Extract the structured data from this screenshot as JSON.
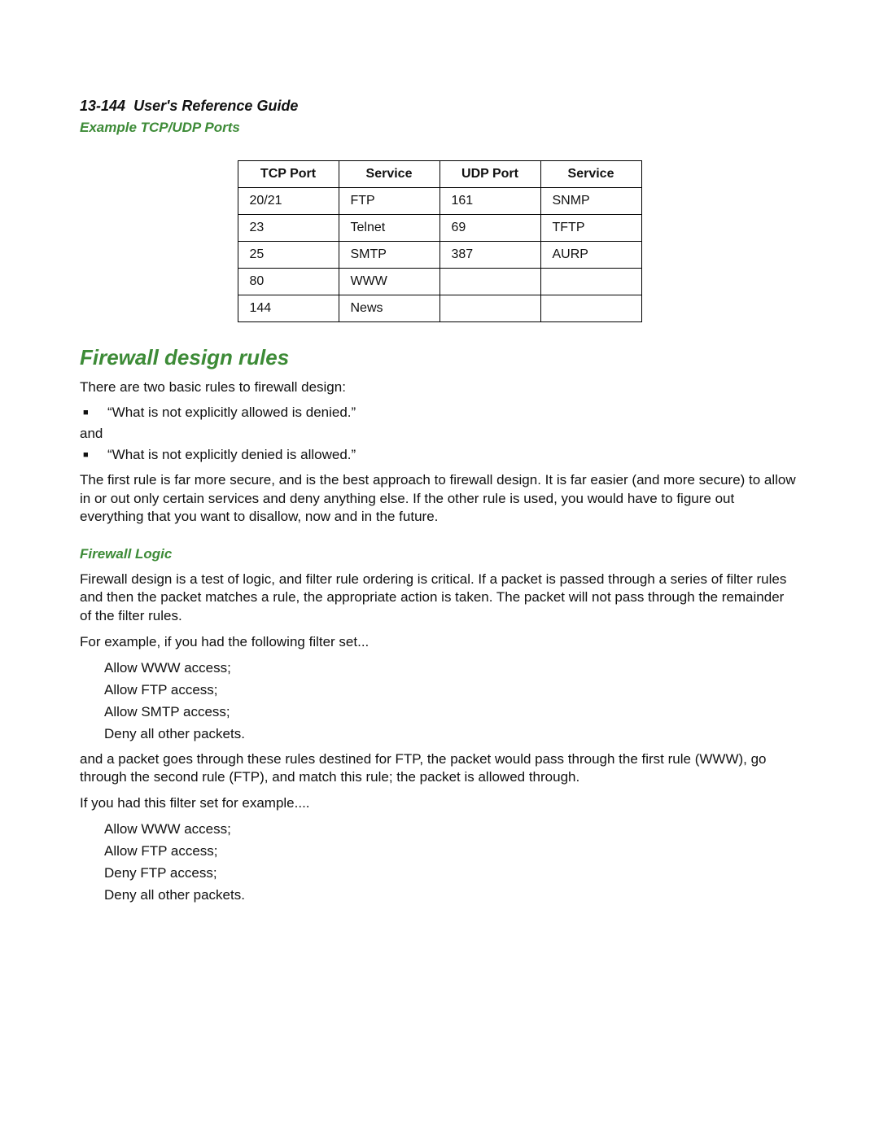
{
  "header": {
    "page_label": "13-144",
    "guide_title": "User's Reference Guide",
    "subtitle": "Example TCP/UDP Ports"
  },
  "table": {
    "headers": [
      "TCP Port",
      "Service",
      "UDP Port",
      "Service"
    ],
    "rows": [
      [
        "20/21",
        "FTP",
        "161",
        "SNMP"
      ],
      [
        "23",
        "Telnet",
        "69",
        "TFTP"
      ],
      [
        "25",
        "SMTP",
        "387",
        "AURP"
      ],
      [
        "80",
        "WWW",
        "",
        ""
      ],
      [
        "144",
        "News",
        "",
        ""
      ]
    ]
  },
  "section": {
    "title": "Firewall design rules",
    "intro": "There are two basic rules to firewall design:",
    "rule1": "“What is not explicitly allowed is denied.”",
    "and": "and",
    "rule2": "“What is not explicitly denied is allowed.”",
    "paragraph1": "The first rule is far more secure, and is the best approach to firewall design. It is far easier (and more secure) to allow in or out only certain services and deny anything else. If the other rule is used, you would have to figure out everything that you want to disallow, now and in the future."
  },
  "logic": {
    "title": "Firewall Logic",
    "paragraph1": "Firewall design is a test of logic, and filter rule ordering is critical. If a packet is passed through a series of filter rules and then the packet matches a rule, the appropriate action is taken. The packet will not pass through the remainder of the filter rules.",
    "paragraph2": "For example, if you had the following filter set...",
    "set1": [
      "Allow WWW access;",
      "Allow FTP access;",
      "Allow SMTP access;",
      "Deny all other packets."
    ],
    "paragraph3": "and a packet goes through these rules destined for FTP, the packet would pass through the first rule (WWW), go through the second rule (FTP), and match this rule; the packet is allowed through.",
    "paragraph4": "If you had this filter set for example....",
    "set2": [
      "Allow WWW access;",
      "Allow FTP access;",
      "Deny FTP access;",
      "Deny all other packets."
    ]
  }
}
